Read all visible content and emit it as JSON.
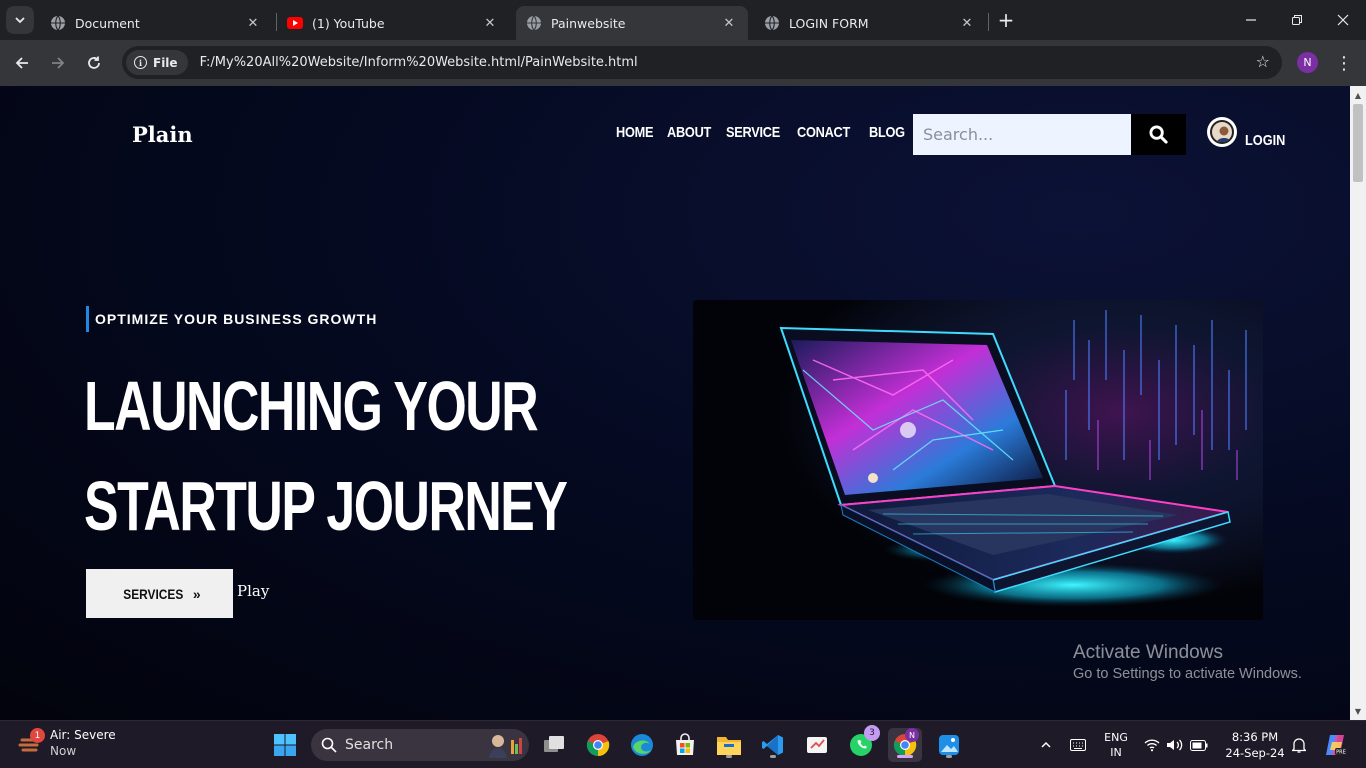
{
  "browser": {
    "tabs": [
      {
        "title": "Document",
        "favicon": "globe-icon",
        "active": false
      },
      {
        "title": "(1) YouTube",
        "favicon": "youtube-icon",
        "active": false
      },
      {
        "title": "Painwebsite",
        "favicon": "globe-icon",
        "active": true
      },
      {
        "title": "LOGIN FORM",
        "favicon": "globe-icon",
        "active": false
      }
    ],
    "security_chip": "File",
    "url": "F:/My%20All%20Website/Inform%20Website.html/PainWebsite.html",
    "profile_initial": "N"
  },
  "site": {
    "brand": "Plain",
    "nav": [
      "HOME",
      "ABOUT",
      "SERVICE",
      "CONACT",
      "BLOG"
    ],
    "search_placeholder": "Search...",
    "login_label": "LOGIN",
    "hero": {
      "eyebrow": "OPTIMIZE YOUR BUSINESS GROWTH",
      "headline_line1": "LAUNCHING YOUR",
      "headline_line2": "STARTUP JOURNEY",
      "services_button": "SERVICES",
      "play_label": "Play"
    }
  },
  "watermark": {
    "title": "Activate Windows",
    "subtitle": "Go to Settings to activate Windows."
  },
  "taskbar": {
    "weather_title": "Air: Severe",
    "weather_sub": "Now",
    "weather_badge": "1",
    "search_label": "Search",
    "whatsapp_badge": "3",
    "chrome_profile_badge": "N",
    "language_line1": "ENG",
    "language_line2": "IN",
    "time": "8:36 PM",
    "date": "24-Sep-24"
  }
}
